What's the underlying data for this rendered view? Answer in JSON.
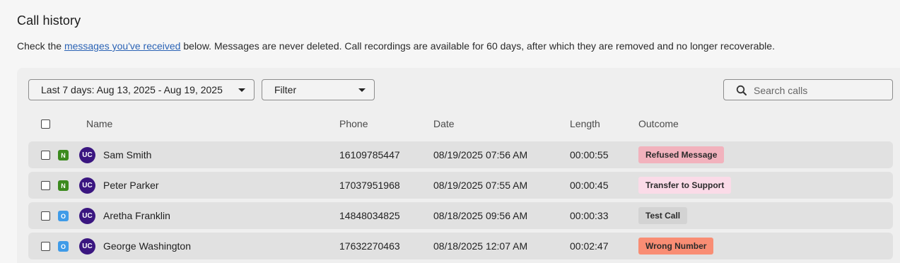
{
  "page": {
    "title": "Call history",
    "intro_before": "Check the ",
    "intro_link": "messages you've received",
    "intro_after": " below. Messages are never deleted. Call recordings are available for 60 days, after which they are removed and no longer recoverable."
  },
  "toolbar": {
    "date_range": "Last 7 days: Aug 13, 2025 - Aug 19, 2025",
    "filter": "Filter",
    "search_placeholder": "Search calls"
  },
  "table": {
    "columns": [
      "Name",
      "Phone",
      "Date",
      "Length",
      "Outcome"
    ],
    "rows": [
      {
        "tag": "N",
        "tag_color": "#3b8a1e",
        "avatar": "UC",
        "name": "Sam Smith",
        "phone": "16109785447",
        "date": "08/19/2025 07:56 AM",
        "length": "00:00:55",
        "outcome": "Refused Message",
        "outcome_color": "#f2b2bd"
      },
      {
        "tag": "N",
        "tag_color": "#3b8a1e",
        "avatar": "UC",
        "name": "Peter Parker",
        "phone": "17037951968",
        "date": "08/19/2025 07:55 AM",
        "length": "00:00:45",
        "outcome": "Transfer to Support",
        "outcome_color": "#fbdbe8"
      },
      {
        "tag": "O",
        "tag_color": "#3f9be8",
        "avatar": "UC",
        "name": "Aretha Franklin",
        "phone": "14848034825",
        "date": "08/18/2025 09:56 AM",
        "length": "00:00:33",
        "outcome": "Test Call",
        "outcome_color": "#d3d3d3"
      },
      {
        "tag": "O",
        "tag_color": "#3f9be8",
        "avatar": "UC",
        "name": "George Washington",
        "phone": "17632270463",
        "date": "08/18/2025 12:07 AM",
        "length": "00:02:47",
        "outcome": "Wrong Number",
        "outcome_color": "#f98d74"
      }
    ]
  },
  "icons": {
    "search": "search-icon",
    "caret": "caret-down-icon"
  }
}
